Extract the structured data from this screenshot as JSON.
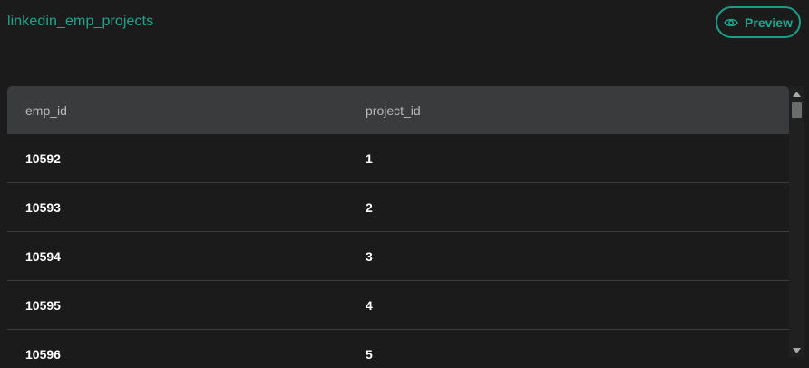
{
  "table": {
    "name": "linkedin_emp_projects"
  },
  "toolbar": {
    "preview_label": "Preview",
    "preview_icon": "eye-icon"
  },
  "grid": {
    "columns": [
      "emp_id",
      "project_id"
    ],
    "rows": [
      [
        "10592",
        "1"
      ],
      [
        "10593",
        "2"
      ],
      [
        "10594",
        "3"
      ],
      [
        "10595",
        "4"
      ],
      [
        "10596",
        "5"
      ]
    ]
  },
  "colors": {
    "accent": "#1fa58c",
    "background": "#1b1b1b",
    "header_bg": "#3a3b3d"
  }
}
